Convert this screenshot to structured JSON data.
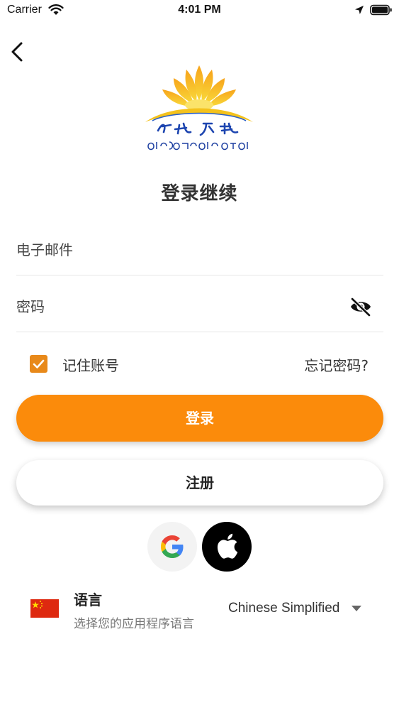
{
  "status_bar": {
    "carrier": "Carrier",
    "time": "4:01 PM"
  },
  "logo": {
    "alt_text": "晨光广电 / Myanmar brand text"
  },
  "title": "登录继续",
  "form": {
    "email_placeholder": "电子邮件",
    "password_placeholder": "密码",
    "remember_label": "记住账号",
    "remember_checked": true,
    "forgot_link": "忘记密码?"
  },
  "buttons": {
    "login": "登录",
    "register": "注册"
  },
  "social": {
    "google_icon": "google-icon",
    "apple_icon": "apple-icon"
  },
  "language": {
    "title": "语言",
    "subtitle": "选择您的应用程序语言",
    "selected": "Chinese Simplified",
    "flag_icon": "china-flag-icon"
  },
  "colors": {
    "accent": "#fb8b0b",
    "checkbox": "#e8891a"
  }
}
